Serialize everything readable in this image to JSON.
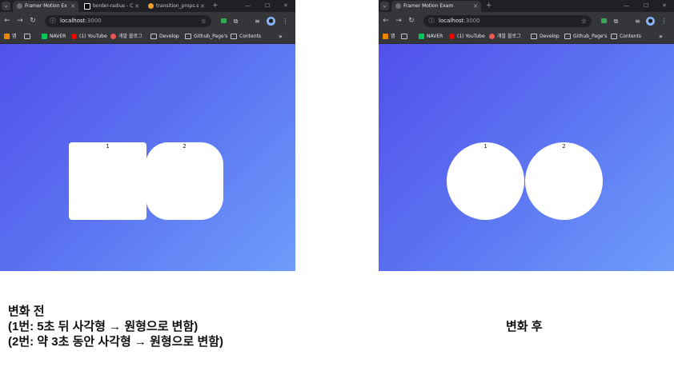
{
  "before": {
    "tabs": [
      {
        "title": "Framer Motion Ex",
        "active": true
      },
      {
        "title": "border-radius - C",
        "active": false
      },
      {
        "title": "transition_props.s",
        "active": false
      }
    ],
    "url": {
      "host": "localhost",
      "port": ":3000"
    },
    "bookmarks": [
      "앱",
      "NAVER",
      "(1) YouTube",
      "개발 블로그",
      "Develop",
      "Github_Page's",
      "Contents"
    ],
    "boxes": [
      {
        "label": "1",
        "shape": "square"
      },
      {
        "label": "2",
        "shape": "rounded"
      }
    ]
  },
  "after": {
    "tabs": [
      {
        "title": "Framer Motion Exam",
        "active": true
      }
    ],
    "url": {
      "host": "localhost",
      "port": ":3000"
    },
    "bookmarks": [
      "앱",
      "NAVER",
      "(1) YouTube",
      "개발 블로그",
      "Develop",
      "Github_Page's",
      "Contents"
    ],
    "boxes": [
      {
        "label": "1",
        "shape": "circle"
      },
      {
        "label": "2",
        "shape": "circle"
      }
    ]
  },
  "caption_before": {
    "line1": "변화 전",
    "line2": "(1번: 5초 뒤 사각형 → 원형으로 변함)",
    "line3": "(2번: 약 3초 동안 사각형 → 원형으로 변함)"
  },
  "caption_after": "변화 후",
  "colors": {
    "gradient_start": "#5151eb",
    "gradient_end": "#6e9cfb",
    "chrome_dark": "#35363a"
  },
  "icons": {
    "tab_menu": "chevron-down-icon",
    "back": "arrow-left-icon",
    "forward": "arrow-right-icon",
    "reload": "reload-icon",
    "site_info": "info-icon",
    "bookmark": "star-icon",
    "extensions": "puzzle-icon",
    "more": "more-vert-icon"
  }
}
